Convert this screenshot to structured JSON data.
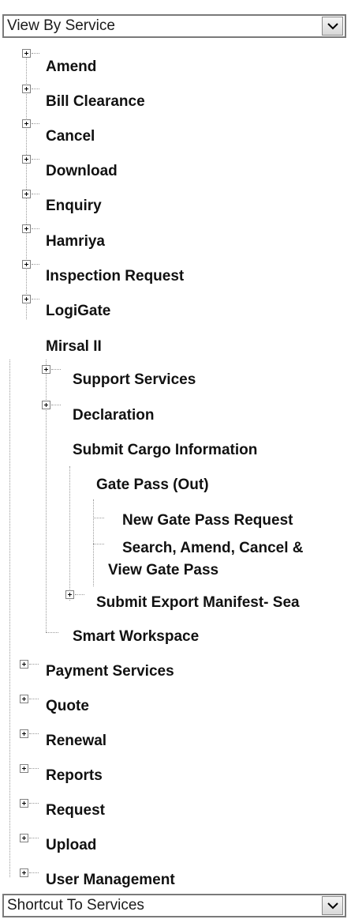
{
  "service_select": {
    "value": "View By Service"
  },
  "tree": {
    "top_items": [
      "Amend",
      "Bill Clearance",
      "Cancel",
      "Download",
      "Enquiry",
      "Hamriya",
      "Inspection Request",
      "LogiGate"
    ],
    "mirsal": {
      "label": "Mirsal II",
      "children": {
        "support_services": "Support Services",
        "declaration": "Declaration",
        "submit_cargo": {
          "label": "Submit Cargo Information",
          "gate_pass": {
            "label": "Gate Pass (Out)",
            "new_request": "New Gate Pass Request",
            "search_line1": "Search, Amend, Cancel &",
            "search_line2": "View Gate Pass"
          },
          "export_manifest": "Submit Export Manifest- Sea"
        },
        "smart_workspace": "Smart Workspace"
      }
    },
    "bottom_items": [
      "Payment Services",
      "Quote",
      "Renewal",
      "Reports",
      "Request",
      "Upload",
      "User Management"
    ]
  },
  "shortcut_select": {
    "value": "Shortcut To Services"
  }
}
